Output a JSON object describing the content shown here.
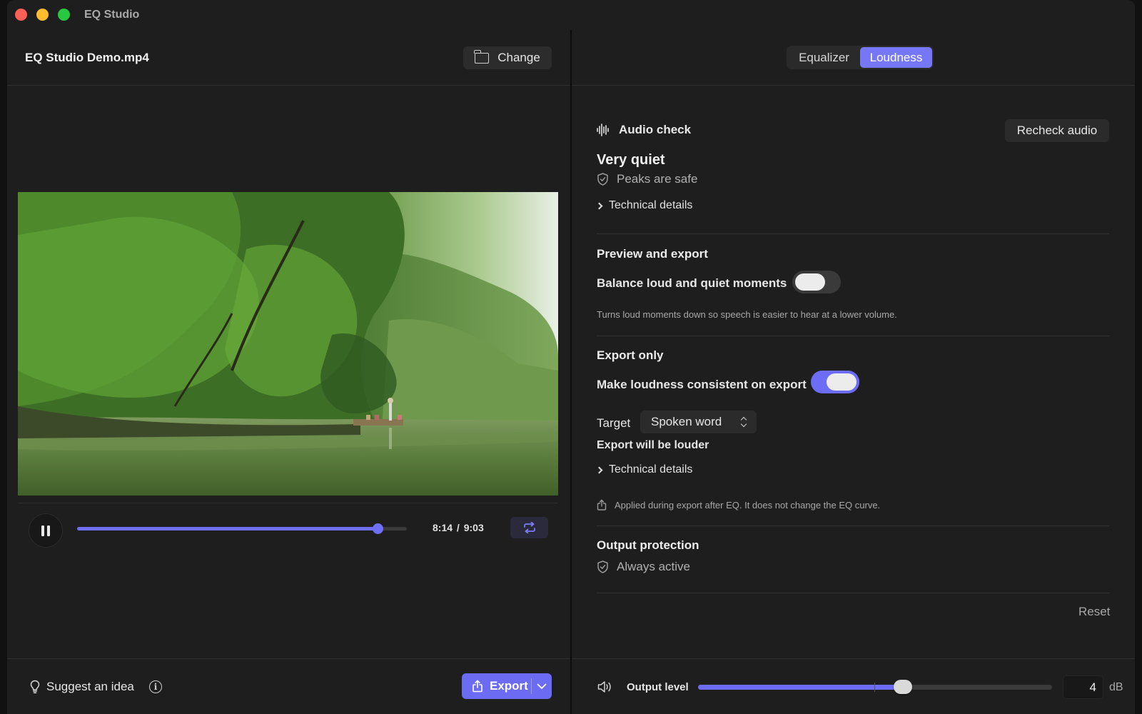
{
  "window": {
    "title": "EQ Studio"
  },
  "left": {
    "file_name": "EQ Studio Demo.mp4",
    "change_label": "Change",
    "player": {
      "current_time": "8:14",
      "separator": "/",
      "duration": "9:03",
      "progress_fraction": 0.911
    },
    "suggest_label": "Suggest an idea",
    "info_glyph": "i",
    "export_label": "Export"
  },
  "right": {
    "tabs": [
      {
        "label": "Equalizer",
        "active": false
      },
      {
        "label": "Loudness",
        "active": true
      }
    ],
    "audio_check": {
      "title": "Audio check",
      "recheck_label": "Recheck audio",
      "status": "Very quiet",
      "peaks": "Peaks are safe",
      "details_label": "Technical details"
    },
    "preview_export": {
      "title": "Preview and export",
      "balance_label": "Balance loud and quiet moments",
      "balance_on": false,
      "balance_help": "Turns loud moments down so speech is easier to hear at a lower volume."
    },
    "export_only": {
      "title": "Export only",
      "consistent_label": "Make loudness consistent on export",
      "consistent_on": true,
      "target_label": "Target",
      "target_value": "Spoken word",
      "louder_label": "Export will be louder",
      "details_label": "Technical details",
      "note": "Applied during export after EQ. It does not change the EQ curve."
    },
    "output_protection": {
      "title": "Output protection",
      "status": "Always active"
    },
    "reset_label": "Reset",
    "output_level": {
      "label": "Output level",
      "value": "4",
      "unit": "dB",
      "level_fraction": 0.578
    }
  },
  "colors": {
    "accent": "#6c6df4",
    "background": "#1e1e1e",
    "traffic_red": "#fe5f57",
    "traffic_yellow": "#febc2e",
    "traffic_green": "#28c840"
  },
  "icons": [
    "folder-icon",
    "pause-icon",
    "repeat-icon",
    "lightbulb-icon",
    "info-icon",
    "share-icon",
    "chevron-down-icon",
    "waveform-icon",
    "shield-check-icon",
    "chevron-right-icon",
    "chevron-up-down-icon",
    "speaker-icon"
  ]
}
